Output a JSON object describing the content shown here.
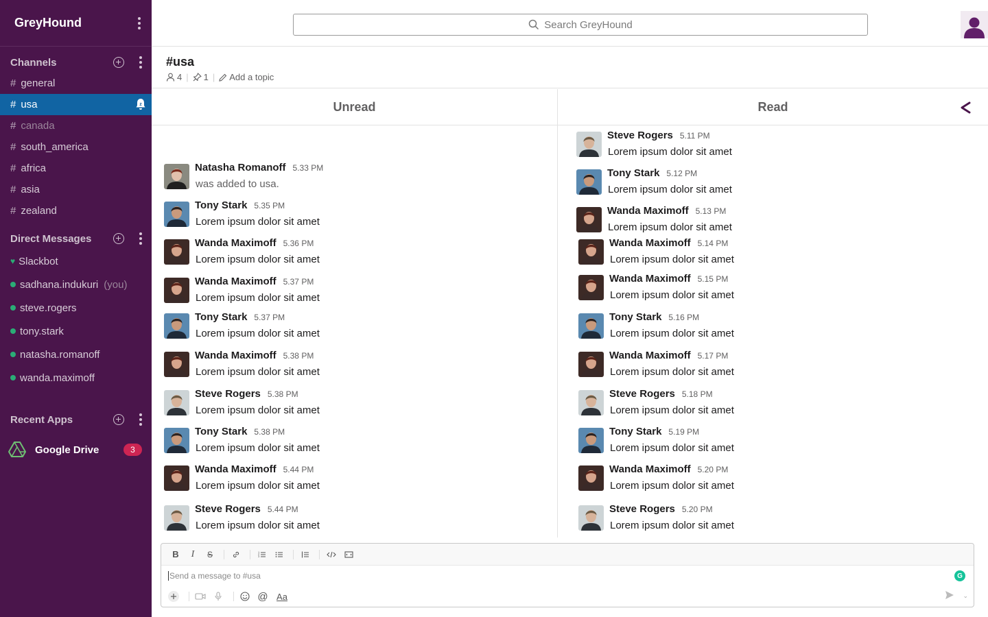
{
  "workspace": {
    "name": "GreyHound"
  },
  "sidebar": {
    "channels_title": "Channels",
    "channels": [
      {
        "name": "general",
        "state": "normal"
      },
      {
        "name": "usa",
        "state": "active"
      },
      {
        "name": "canada",
        "state": "muted"
      },
      {
        "name": "south_america",
        "state": "normal"
      },
      {
        "name": "africa",
        "state": "normal"
      },
      {
        "name": "asia",
        "state": "normal"
      },
      {
        "name": "zealand",
        "state": "normal"
      }
    ],
    "dm_title": "Direct Messages",
    "dms": [
      {
        "name": "Slackbot",
        "kind": "heart"
      },
      {
        "name": "sadhana.indukuri",
        "suffix": "(you)",
        "kind": "dot"
      },
      {
        "name": "steve.rogers",
        "kind": "dot"
      },
      {
        "name": "tony.stark",
        "kind": "dot"
      },
      {
        "name": "natasha.romanoff",
        "kind": "dot"
      },
      {
        "name": "wanda.maximoff",
        "kind": "dot"
      }
    ],
    "apps_title": "Recent Apps",
    "apps": [
      {
        "name": "Google Drive",
        "badge": "3"
      }
    ]
  },
  "search": {
    "placeholder": "Search GreyHound"
  },
  "channel": {
    "title": "#usa",
    "members": "4",
    "pins": "1",
    "topic_link": "Add a topic"
  },
  "columns": {
    "unread_title": "Unread",
    "read_title": "Read"
  },
  "unread_messages": [
    {
      "author": "Natasha Romanoff",
      "time": "5.33 PM",
      "text": "was added to usa.",
      "system": true,
      "avatar": "natasha"
    },
    {
      "author": "Tony Stark",
      "time": "5.35 PM",
      "text": "Lorem ipsum dolor sit amet",
      "avatar": "tony"
    },
    {
      "author": "Wanda Maximoff",
      "time": "5.36 PM",
      "text": "Lorem ipsum dolor sit amet",
      "avatar": "wanda"
    },
    {
      "author": "Wanda Maximoff",
      "time": "5.37 PM",
      "text": "Lorem ipsum dolor sit amet",
      "avatar": "wanda"
    },
    {
      "author": "Tony Stark",
      "time": "5.37 PM",
      "text": "Lorem ipsum dolor sit amet",
      "avatar": "tony"
    },
    {
      "author": "Wanda Maximoff",
      "time": "5.38 PM",
      "text": "Lorem ipsum dolor sit amet",
      "avatar": "wanda"
    },
    {
      "author": "Steve Rogers",
      "time": "5.38 PM",
      "text": "Lorem ipsum dolor sit amet",
      "avatar": "steve"
    },
    {
      "author": "Tony Stark",
      "time": "5.38 PM",
      "text": "Lorem ipsum dolor sit amet",
      "avatar": "tony"
    },
    {
      "author": "Wanda Maximoff",
      "time": "5.44 PM",
      "text": "Lorem ipsum dolor sit amet",
      "avatar": "wanda"
    },
    {
      "author": "Steve Rogers",
      "time": "5.44 PM",
      "text": "Lorem ipsum dolor sit amet",
      "avatar": "steve"
    }
  ],
  "read_messages": [
    {
      "author": "Steve Rogers",
      "time": "5.11 PM",
      "text": "Lorem ipsum dolor sit amet",
      "avatar": "steve"
    },
    {
      "author": "Tony Stark",
      "time": "5.12 PM",
      "text": "Lorem ipsum dolor sit amet",
      "avatar": "tony"
    },
    {
      "author": "Wanda Maximoff",
      "time": "5.13 PM",
      "text": "Lorem ipsum dolor sit amet",
      "avatar": "wanda"
    },
    {
      "author": "Wanda Maximoff",
      "time": "5.14 PM",
      "text": "Lorem ipsum dolor sit amet",
      "avatar": "wanda"
    },
    {
      "author": "Wanda Maximoff",
      "time": "5.15 PM",
      "text": "Lorem ipsum dolor sit amet",
      "avatar": "wanda"
    },
    {
      "author": "Tony Stark",
      "time": "5.16 PM",
      "text": "Lorem ipsum dolor sit amet",
      "avatar": "tony"
    },
    {
      "author": "Wanda Maximoff",
      "time": "5.17 PM",
      "text": "Lorem ipsum dolor sit amet",
      "avatar": "wanda"
    },
    {
      "author": "Steve Rogers",
      "time": "5.18 PM",
      "text": "Lorem ipsum dolor sit amet",
      "avatar": "steve"
    },
    {
      "author": "Tony Stark",
      "time": "5.19 PM",
      "text": "Lorem ipsum dolor sit amet",
      "avatar": "tony"
    },
    {
      "author": "Wanda Maximoff",
      "time": "5.20 PM",
      "text": "Lorem ipsum dolor sit amet",
      "avatar": "wanda"
    },
    {
      "author": "Steve Rogers",
      "time": "5.20 PM",
      "text": "Lorem ipsum dolor sit amet",
      "avatar": "steve"
    }
  ],
  "composer": {
    "placeholder": "Send a message to #usa",
    "format_buttons": [
      "bold-icon",
      "italic-icon",
      "strikethrough-icon",
      "link-icon",
      "ordered-list-icon",
      "bulleted-list-icon",
      "blockquote-icon",
      "code-icon",
      "code-block-icon"
    ],
    "text_style_label": "Aa"
  },
  "colors": {
    "sidebar": "#4a154b",
    "active_channel": "#1164a3",
    "presence": "#2bac76",
    "badge": "#cd2553"
  }
}
